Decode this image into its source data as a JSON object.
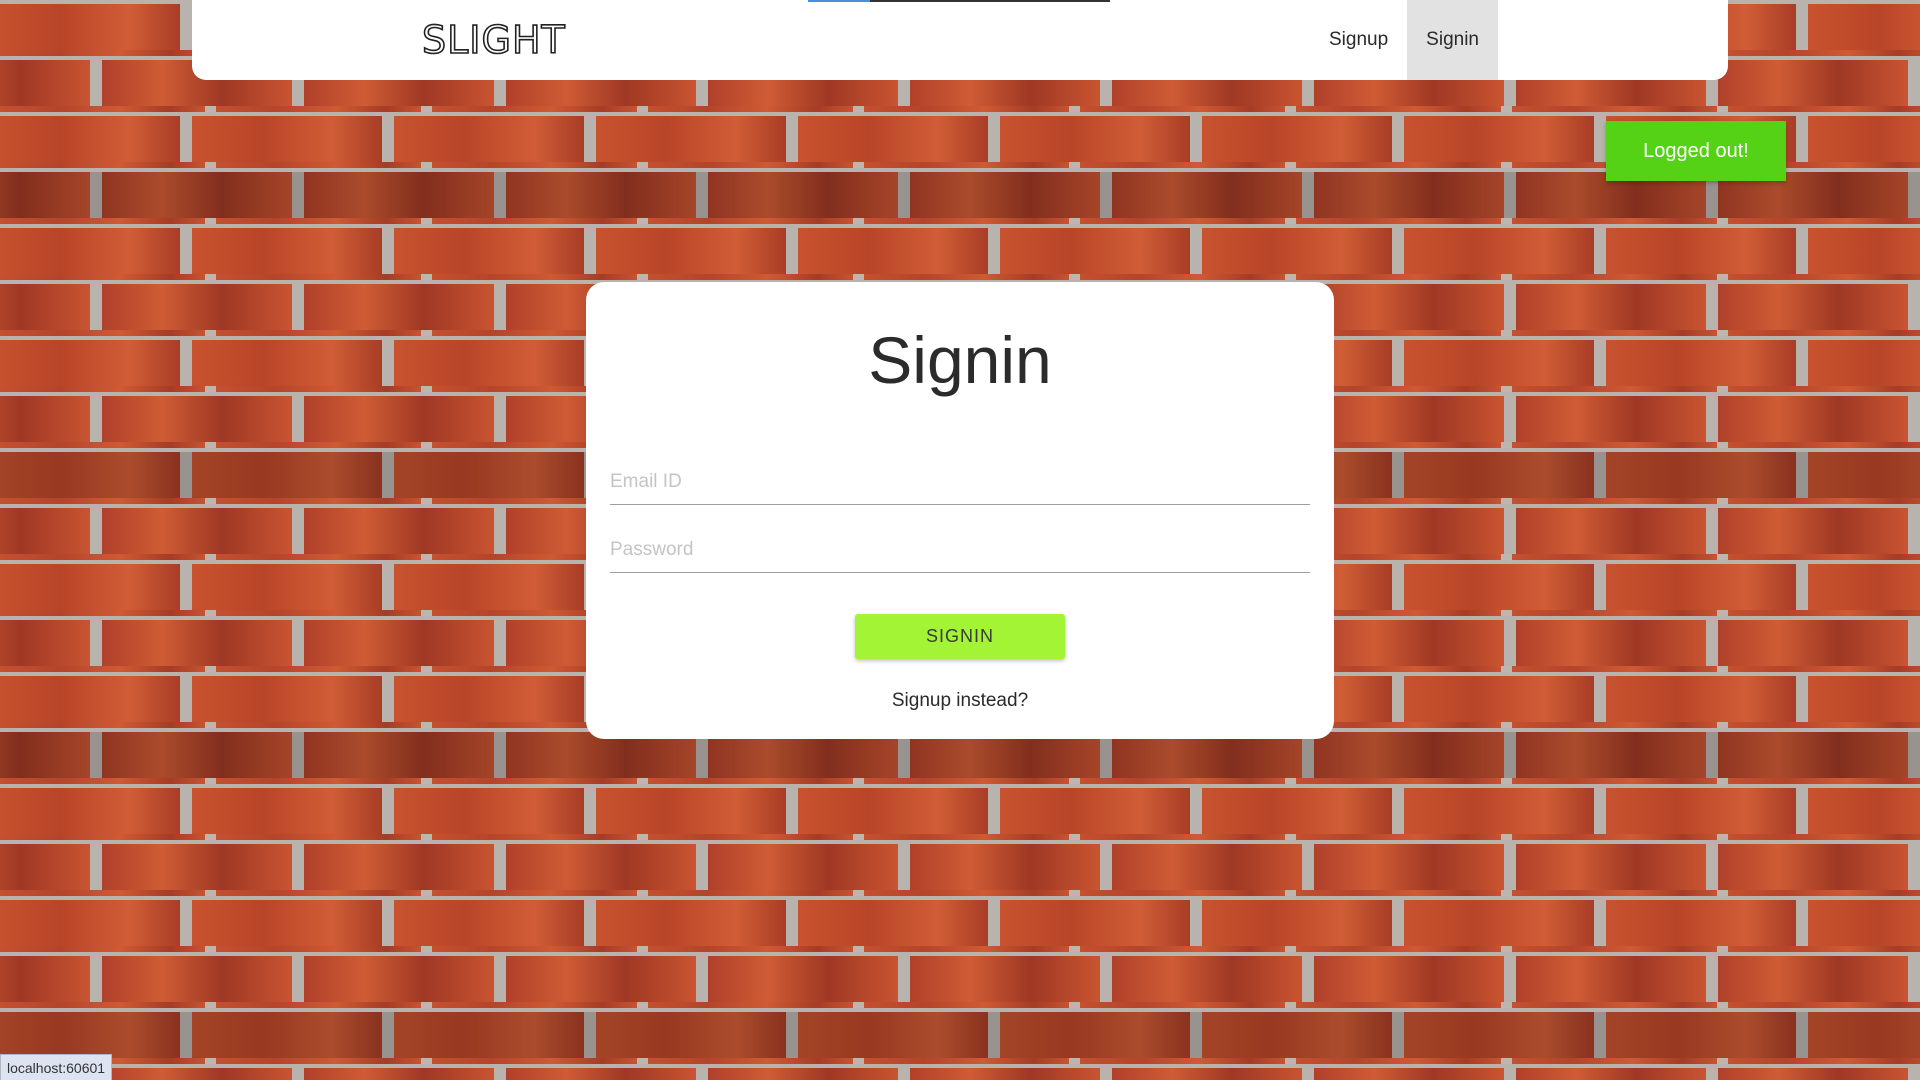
{
  "navbar": {
    "logo": "SLIGHT",
    "links": [
      {
        "label": "Signup",
        "active": false
      },
      {
        "label": "Signin",
        "active": true
      }
    ]
  },
  "toast": {
    "message": "Logged out!",
    "color": "#55d116"
  },
  "form": {
    "title": "Signin",
    "email_placeholder": "Email ID",
    "password_placeholder": "Password",
    "submit_label": "SIGNIN",
    "alt_link": "Signup instead?"
  },
  "status_bar": {
    "url": "localhost:60601"
  },
  "colors": {
    "accent": "#a3f435",
    "background": "brick-wall"
  }
}
